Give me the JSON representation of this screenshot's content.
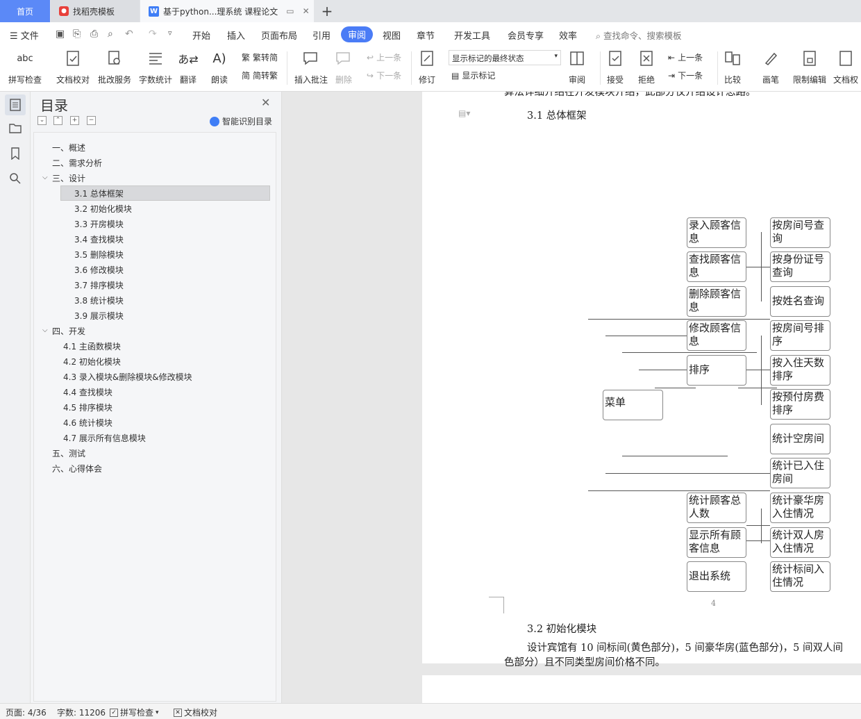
{
  "tabs": {
    "home": "首页",
    "template": "找稻壳模板",
    "document": "基于python...理系统 课程论文"
  },
  "menu": {
    "file": "文件",
    "items": [
      "开始",
      "插入",
      "页面布局",
      "引用",
      "审阅",
      "视图",
      "章节",
      "开发工具",
      "会员专享",
      "效率"
    ],
    "active": "审阅",
    "search": "查找命令、搜索模板"
  },
  "ribbon": {
    "spell": "拼写检查",
    "proof": "文档校对",
    "batch": "批改服务",
    "wordcount": "字数统计",
    "translate": "翻译",
    "read": "朗读",
    "to_trad": "繁转简",
    "to_simp": "简转繁",
    "insert_comment": "插入批注",
    "delete": "删除",
    "prev": "上一条",
    "next": "下一条",
    "revise": "修订",
    "markup_state": "显示标记的最终状态",
    "show_markup": "显示标记",
    "review": "审阅",
    "accept": "接受",
    "reject": "拒绝",
    "prev2": "上一条",
    "next2": "下一条",
    "compare": "比较",
    "pen": "画笔",
    "restrict": "限制编辑",
    "doc_perm": "文档权"
  },
  "toc": {
    "title": "目录",
    "smart": "智能识别目录",
    "items": [
      {
        "label": "一、概述"
      },
      {
        "label": "二、需求分析"
      },
      {
        "label": "三、设计"
      },
      {
        "label": "3.1 总体框架"
      },
      {
        "label": "3.2 初始化模块"
      },
      {
        "label": "3.3 开房模块"
      },
      {
        "label": "3.4 查找模块"
      },
      {
        "label": "3.5 删除模块"
      },
      {
        "label": "3.6 修改模块"
      },
      {
        "label": "3.7 排序模块"
      },
      {
        "label": "3.8 统计模块"
      },
      {
        "label": "3.9 展示模块"
      },
      {
        "label": "四、开发"
      },
      {
        "label": "4.1 主函数模块"
      },
      {
        "label": "4.2 初始化模块"
      },
      {
        "label": "4.3 录入模块&删除模块&修改模块"
      },
      {
        "label": "4.4 查找模块"
      },
      {
        "label": "4.5 排序模块"
      },
      {
        "label": "4.6 统计模块"
      },
      {
        "label": "4.7 展示所有信息模块"
      },
      {
        "label": "五、测试"
      },
      {
        "label": "六、心得体会"
      }
    ],
    "selected": "3.1 总体框架"
  },
  "doc": {
    "top_text": "算法详细介绍在开发模块介绍，此部分仅介绍设计思路。",
    "heading_31": "3.1 总体框架",
    "diagram": {
      "menu": "菜单",
      "middle": [
        "录入顾客信息",
        "查找顾客信息",
        "删除顾客信息",
        "修改顾客信息",
        "排序",
        "统计顾客总人数",
        "显示所有顾客信息",
        "退出系统"
      ],
      "right": [
        "按房间号查询",
        "按身份证号查询",
        "按姓名查询",
        "按房间号排序",
        "按入住天数排序",
        "按预付房费排序",
        "统计空房间",
        "统计已入住房间",
        "统计豪华房入住情况",
        "统计双人房入住情况",
        "统计标间入住情况"
      ]
    },
    "heading_32": "3.2 初始化模块",
    "para_32_line1": "设计宾馆有 10 间标间(黄色部分)，5 间豪华房(蓝色部分)，5 间双人间",
    "para_32_line2": "色部分）且不同类型房间价格不同。",
    "page_number": "4"
  },
  "status": {
    "page": "页面: 4/36",
    "words": "字数: 11206",
    "spell": "拼写检查",
    "proof": "文档校对"
  }
}
